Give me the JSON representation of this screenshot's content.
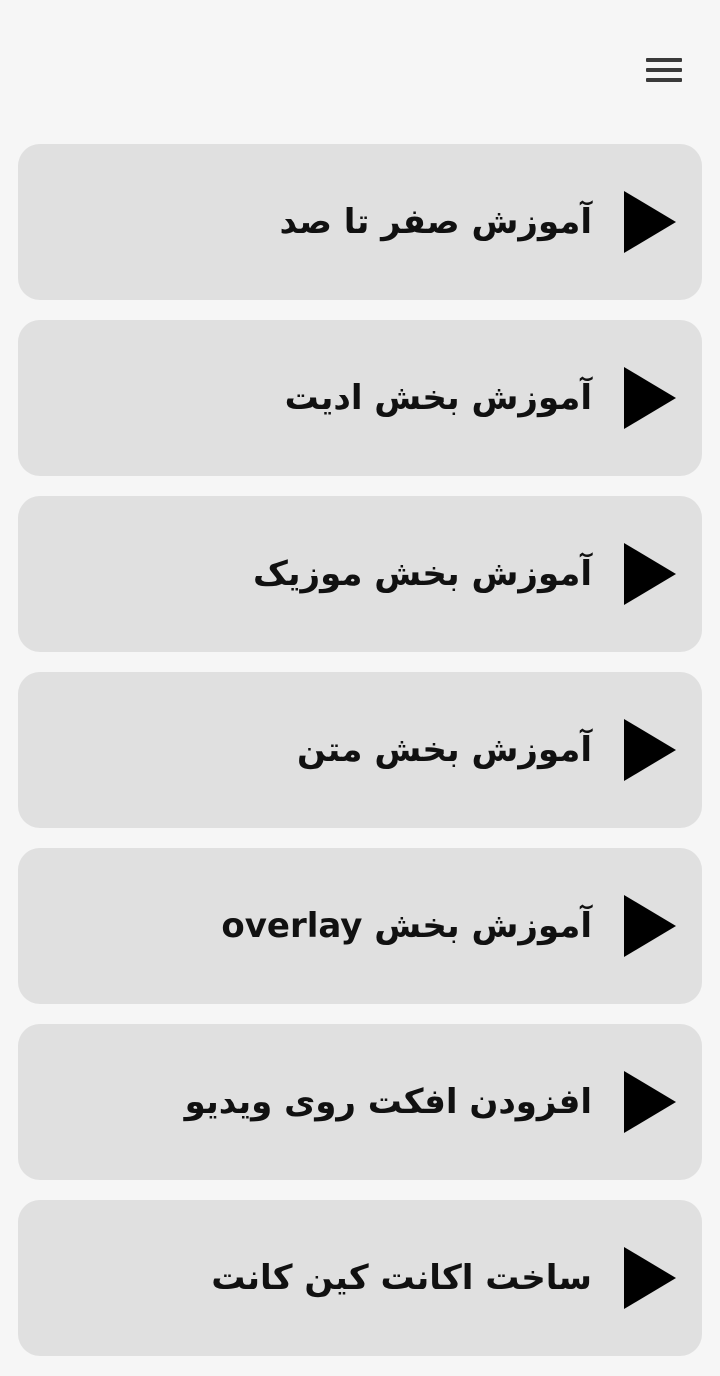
{
  "header": {
    "menu_icon": "hamburger-menu-icon"
  },
  "items": [
    {
      "label": "آموزش صفر تا صد",
      "icon": "play-icon"
    },
    {
      "label": "آموزش بخش ادیت",
      "icon": "play-icon"
    },
    {
      "label": "آموزش بخش موزیک",
      "icon": "play-icon"
    },
    {
      "label": "آموزش بخش متن",
      "icon": "play-icon"
    },
    {
      "label": "آموزش بخش overlay",
      "icon": "play-icon"
    },
    {
      "label": "افزودن افکت روی ویدیو",
      "icon": "play-icon"
    },
    {
      "label": "ساخت اکانت کین کانت",
      "icon": "play-icon"
    }
  ],
  "colors": {
    "background": "#f6f6f6",
    "card": "#e0e0e0",
    "text": "#111111",
    "icon": "#000000"
  }
}
